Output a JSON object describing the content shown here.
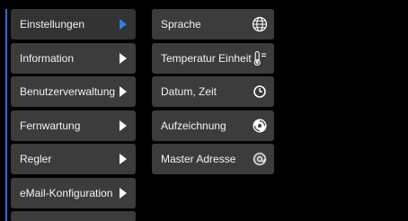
{
  "menu": {
    "items": [
      {
        "label": "Einstellungen",
        "active": true
      },
      {
        "label": "Information",
        "active": false
      },
      {
        "label": "Benutzerverwaltung",
        "active": false
      },
      {
        "label": "Fernwartung",
        "active": false
      },
      {
        "label": "Regler",
        "active": false
      },
      {
        "label": "eMail-Konfiguration",
        "active": false
      }
    ],
    "active_color": "#2f7de0"
  },
  "submenu": {
    "items": [
      {
        "label": "Sprache",
        "icon": "globe-icon"
      },
      {
        "label": "Temperatur Einheit",
        "icon": "thermometer-icon"
      },
      {
        "label": "Datum, Zeit",
        "icon": "clock-icon"
      },
      {
        "label": "Aufzeichnung",
        "icon": "record-disc-icon"
      },
      {
        "label": "Master Adresse",
        "icon": "at-sign-icon"
      }
    ]
  }
}
